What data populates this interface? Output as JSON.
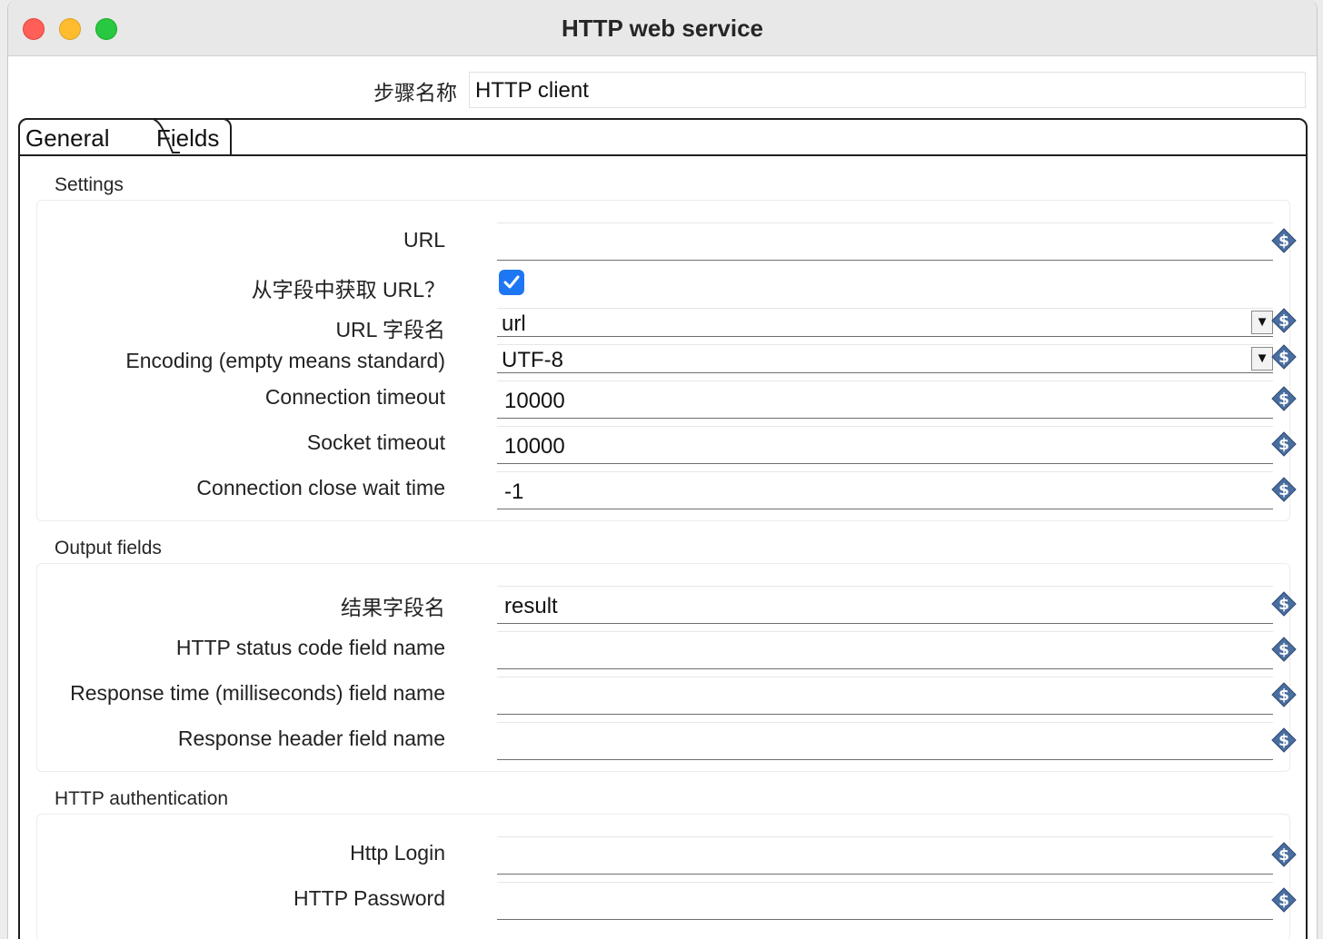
{
  "window": {
    "title": "HTTP web service"
  },
  "step": {
    "label": "步骤名称",
    "value": "HTTP client"
  },
  "tabs": {
    "general": "General",
    "fields": "Fields"
  },
  "settings": {
    "title": "Settings",
    "url_label": "URL",
    "url_value": "",
    "url_from_field_label": "从字段中获取 URL？",
    "url_from_field_checked": true,
    "url_field_label": "URL 字段名",
    "url_field_value": "url",
    "encoding_label": "Encoding (empty means standard)",
    "encoding_value": "UTF-8",
    "conn_timeout_label": "Connection timeout",
    "conn_timeout_value": "10000",
    "socket_timeout_label": "Socket timeout",
    "socket_timeout_value": "10000",
    "close_wait_label": "Connection close wait time",
    "close_wait_value": "-1"
  },
  "output": {
    "title": "Output fields",
    "result_label": "结果字段名",
    "result_value": "result",
    "status_label": "HTTP status code field name",
    "status_value": "",
    "resp_time_label": "Response time (milliseconds) field name",
    "resp_time_value": "",
    "resp_header_label": "Response header field name",
    "resp_header_value": ""
  },
  "auth": {
    "title": "HTTP authentication",
    "login_label": "Http Login",
    "login_value": "",
    "password_label": "HTTP Password",
    "password_value": ""
  },
  "icons": {
    "close": "close-window-icon",
    "minimize": "minimize-window-icon",
    "zoom": "zoom-window-icon",
    "variable": "variable-dollar-icon",
    "dropdown": "dropdown-arrow-icon",
    "check": "checkmark-icon"
  },
  "colors": {
    "accent": "#1e77f2",
    "variable_icon": "#4a6ea0"
  }
}
